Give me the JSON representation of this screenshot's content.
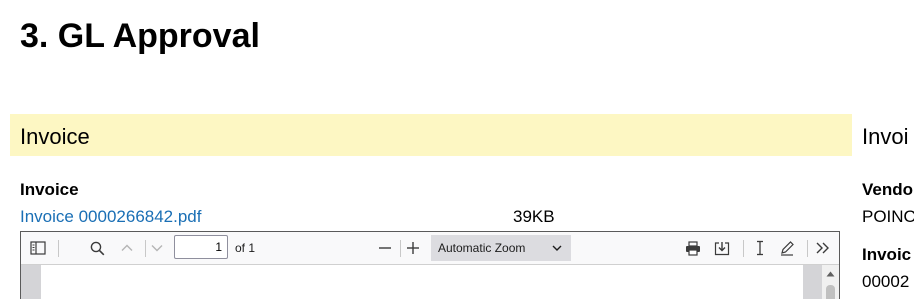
{
  "page": {
    "title": "3. GL Approval"
  },
  "invoice_section": {
    "title": "Invoice",
    "field_label": "Invoice",
    "file_name": "Invoice 0000266842.pdf",
    "file_size": "39KB"
  },
  "right_column": {
    "heading": "Invoi",
    "vendor_label": "Vendo",
    "vendor_value": "POINO",
    "invoice_label": "Invoic",
    "invoice_value": "00002"
  },
  "pdf_viewer": {
    "page_number": "1",
    "page_count": "of 1",
    "zoom": "Automatic Zoom",
    "icons": {
      "sidebar": "sidebar-toggle-icon",
      "find": "search-icon",
      "prev": "chevron-up-icon",
      "next": "chevron-down-icon",
      "zoom_out": "minus-icon",
      "zoom_in": "plus-icon",
      "print": "printer-icon",
      "save": "download-icon",
      "text": "text-cursor-icon",
      "draw": "pen-icon",
      "tools": "double-chevron-icon"
    }
  }
}
